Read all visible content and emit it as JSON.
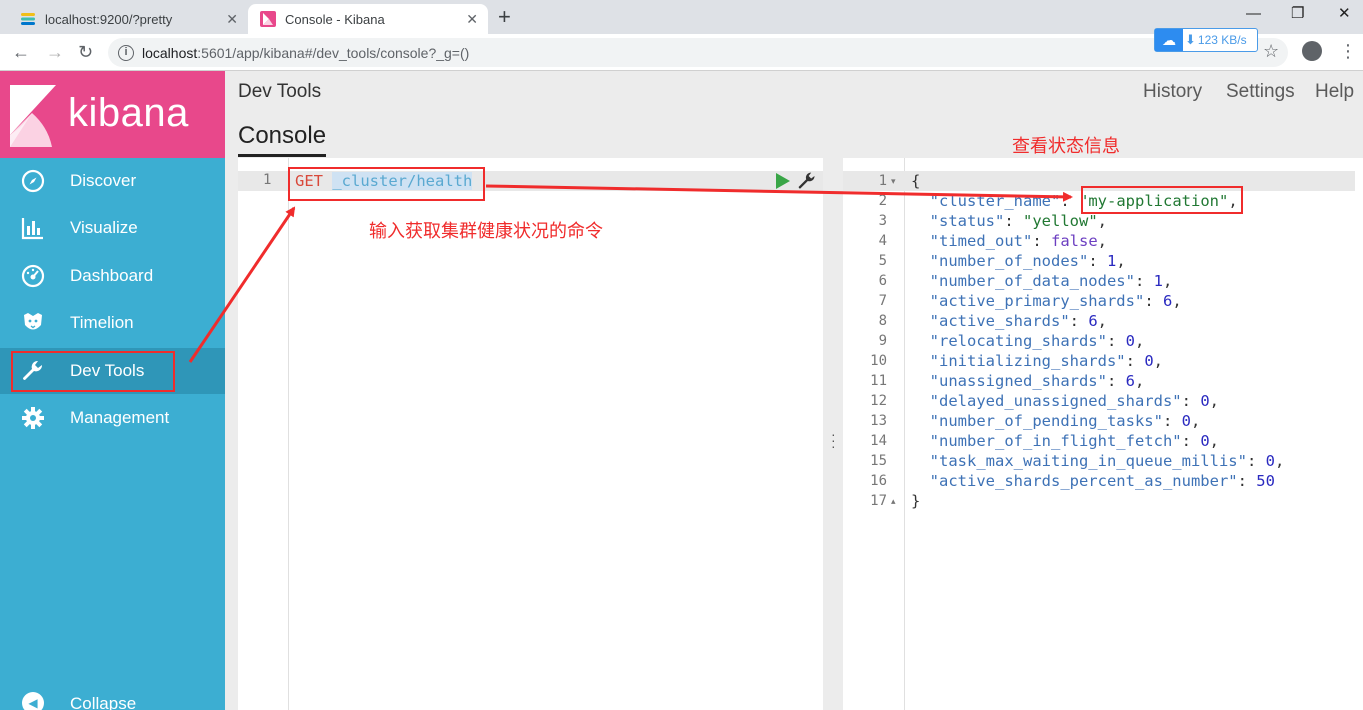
{
  "browser": {
    "tabs": [
      {
        "title": "localhost:9200/?pretty",
        "active": false
      },
      {
        "title": "Console - Kibana",
        "active": true
      }
    ],
    "new_tab_label": "+",
    "url_host": "localhost",
    "url_rest": ":5601/app/kibana#/dev_tools/console?_g=()",
    "speed": "123 KB/s"
  },
  "kibana": {
    "logo_text": "kibana",
    "nav": [
      {
        "label": "Discover",
        "icon": "compass-icon",
        "active": false
      },
      {
        "label": "Visualize",
        "icon": "bar-chart-icon",
        "active": false
      },
      {
        "label": "Dashboard",
        "icon": "dashboard-icon",
        "active": false
      },
      {
        "label": "Timelion",
        "icon": "timelion-icon",
        "active": false
      },
      {
        "label": "Dev Tools",
        "icon": "wrench-icon",
        "active": true
      },
      {
        "label": "Management",
        "icon": "gear-icon",
        "active": false
      }
    ],
    "collapse_label": "Collapse",
    "page_title": "Dev Tools",
    "top_links": [
      "History",
      "Settings",
      "Help"
    ],
    "console_tab": "Console",
    "request": {
      "line_number": "1",
      "method": "GET",
      "path": "_cluster/health"
    },
    "response": [
      {
        "n": "1",
        "fold": "▾",
        "text": "{"
      },
      {
        "n": "2",
        "key": "cluster_name",
        "value": "\"my-application\"",
        "type": "str",
        "comma": ","
      },
      {
        "n": "3",
        "key": "status",
        "value": "\"yellow\"",
        "type": "str",
        "comma": ","
      },
      {
        "n": "4",
        "key": "timed_out",
        "value": "false",
        "type": "bool",
        "comma": ","
      },
      {
        "n": "5",
        "key": "number_of_nodes",
        "value": "1",
        "type": "num",
        "comma": ","
      },
      {
        "n": "6",
        "key": "number_of_data_nodes",
        "value": "1",
        "type": "num",
        "comma": ","
      },
      {
        "n": "7",
        "key": "active_primary_shards",
        "value": "6",
        "type": "num",
        "comma": ","
      },
      {
        "n": "8",
        "key": "active_shards",
        "value": "6",
        "type": "num",
        "comma": ","
      },
      {
        "n": "9",
        "key": "relocating_shards",
        "value": "0",
        "type": "num",
        "comma": ","
      },
      {
        "n": "10",
        "key": "initializing_shards",
        "value": "0",
        "type": "num",
        "comma": ","
      },
      {
        "n": "11",
        "key": "unassigned_shards",
        "value": "6",
        "type": "num",
        "comma": ","
      },
      {
        "n": "12",
        "key": "delayed_unassigned_shards",
        "value": "0",
        "type": "num",
        "comma": ","
      },
      {
        "n": "13",
        "key": "number_of_pending_tasks",
        "value": "0",
        "type": "num",
        "comma": ","
      },
      {
        "n": "14",
        "key": "number_of_in_flight_fetch",
        "value": "0",
        "type": "num",
        "comma": ","
      },
      {
        "n": "15",
        "key": "task_max_waiting_in_queue_millis",
        "value": "0",
        "type": "num",
        "comma": ","
      },
      {
        "n": "16",
        "key": "active_shards_percent_as_number",
        "value": "50",
        "type": "num",
        "comma": ""
      },
      {
        "n": "17",
        "fold": "▴",
        "text": "}"
      }
    ]
  },
  "annotations": {
    "input_note": "输入获取集群健康状况的命令",
    "status_note": "查看状态信息",
    "color": "#f02c2c"
  }
}
